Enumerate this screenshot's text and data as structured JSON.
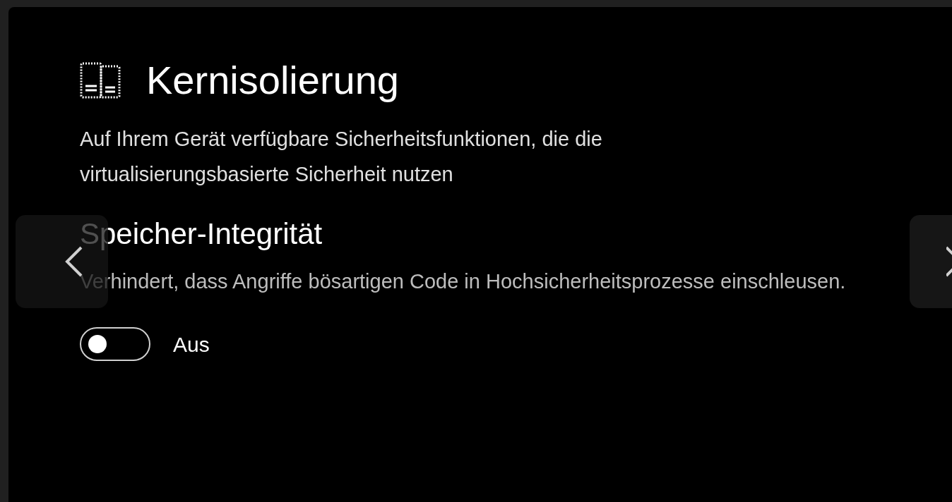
{
  "page": {
    "title": "Kernisolierung",
    "description": "Auf Ihrem Gerät verfügbare Sicherheitsfunktionen, die die virtualisierungsbasierte Sicherheit nutzen"
  },
  "section": {
    "title": "Speicher-Integrität",
    "description": "Verhindert, dass Angriffe bösartigen Code in Hochsicherheitsprozesse einschleusen.",
    "toggle": {
      "on": false,
      "label": "Aus"
    }
  }
}
